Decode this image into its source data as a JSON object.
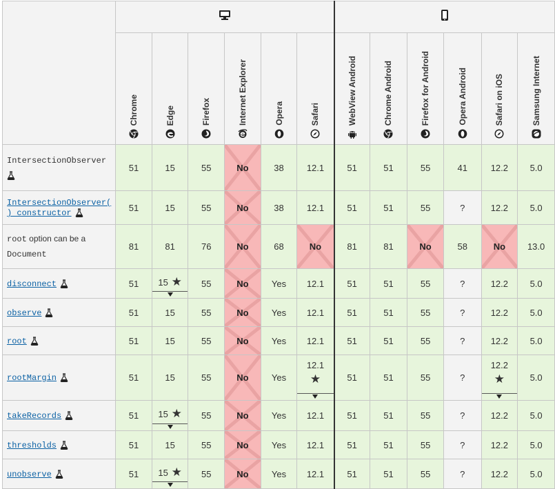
{
  "platforms": {
    "desktop_icon": "desktop-icon",
    "mobile_icon": "mobile-icon"
  },
  "browsers": [
    {
      "name": "Chrome",
      "icon": "chrome-icon"
    },
    {
      "name": "Edge",
      "icon": "edge-icon"
    },
    {
      "name": "Firefox",
      "icon": "firefox-icon"
    },
    {
      "name": "Internet Explorer",
      "icon": "ie-icon"
    },
    {
      "name": "Opera",
      "icon": "opera-icon"
    },
    {
      "name": "Safari",
      "icon": "safari-icon"
    },
    {
      "name": "WebView Android",
      "icon": "android-icon"
    },
    {
      "name": "Chrome Android",
      "icon": "chrome-icon"
    },
    {
      "name": "Firefox for Android",
      "icon": "firefox-icon"
    },
    {
      "name": "Opera Android",
      "icon": "opera-icon"
    },
    {
      "name": "Safari on iOS",
      "icon": "safari-icon"
    },
    {
      "name": "Samsung Internet",
      "icon": "samsung-icon"
    }
  ],
  "rows": [
    {
      "feature": "IntersectionObserver",
      "link": false,
      "values": [
        "51",
        "15",
        "55",
        "No",
        "38",
        "12.1",
        "51",
        "51",
        "55",
        "41",
        "12.2",
        "5.0"
      ]
    },
    {
      "feature_line1": "IntersectionObserver(",
      "feature_line2": ") constructor",
      "link": true,
      "values": [
        "51",
        "15",
        "55",
        "No",
        "38",
        "12.1",
        "51",
        "51",
        "55",
        "?",
        "12.2",
        "5.0"
      ]
    },
    {
      "feature_code": "root",
      "feature_rest1": " option can be a",
      "feature_rest2": "Document",
      "link": false,
      "values": [
        "81",
        "81",
        "76",
        "No",
        "68",
        "No",
        "81",
        "81",
        "No",
        "58",
        "No",
        "13.0"
      ]
    },
    {
      "feature": "disconnect",
      "link": true,
      "values": [
        "51",
        "15",
        "55",
        "No",
        "Yes",
        "12.1",
        "51",
        "51",
        "55",
        "?",
        "12.2",
        "5.0"
      ]
    },
    {
      "feature": "observe",
      "link": true,
      "values": [
        "51",
        "15",
        "55",
        "No",
        "Yes",
        "12.1",
        "51",
        "51",
        "55",
        "?",
        "12.2",
        "5.0"
      ]
    },
    {
      "feature": "root",
      "link": true,
      "values": [
        "51",
        "15",
        "55",
        "No",
        "Yes",
        "12.1",
        "51",
        "51",
        "55",
        "?",
        "12.2",
        "5.0"
      ]
    },
    {
      "feature": "rootMargin",
      "link": true,
      "values": [
        "51",
        "15",
        "55",
        "No",
        "Yes",
        "12.1",
        "51",
        "51",
        "55",
        "?",
        "12.2",
        "5.0"
      ]
    },
    {
      "feature": "takeRecords",
      "link": true,
      "values": [
        "51",
        "15",
        "55",
        "No",
        "Yes",
        "12.1",
        "51",
        "51",
        "55",
        "?",
        "12.2",
        "5.0"
      ]
    },
    {
      "feature": "thresholds",
      "link": true,
      "values": [
        "51",
        "15",
        "55",
        "No",
        "Yes",
        "12.1",
        "51",
        "51",
        "55",
        "?",
        "12.2",
        "5.0"
      ]
    },
    {
      "feature": "unobserve",
      "link": true,
      "values": [
        "51",
        "15",
        "55",
        "No",
        "Yes",
        "12.1",
        "51",
        "51",
        "55",
        "?",
        "12.2",
        "5.0"
      ]
    }
  ],
  "colors": {
    "supported": "#e7f5dc",
    "unsupported": "#f8b8b8",
    "unknown": "#f3f3f3",
    "link": "#0b61a4"
  }
}
